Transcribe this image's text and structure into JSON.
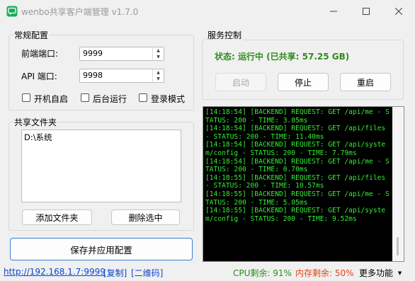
{
  "window": {
    "title": "wenbo共享客户端管理 v1.7.0"
  },
  "config": {
    "legend": "常规配置",
    "frontend_port_label": "前端端口:",
    "frontend_port_value": "9999",
    "api_port_label": "API 端口:",
    "api_port_value": "9998",
    "autostart_label": "开机自启",
    "background_label": "后台运行",
    "login_mode_label": "登录模式"
  },
  "shares": {
    "legend": "共享文件夹",
    "folders": [
      "D:\\系统"
    ],
    "add_label": "添加文件夹",
    "remove_label": "删除选中"
  },
  "save_button_label": "保存并应用配置",
  "service": {
    "legend": "服务控制",
    "status_text": "状态: 运行中 (已共享: 57.25 GB)",
    "status_color": "#2e8b1e",
    "start_label": "启动",
    "stop_label": "停止",
    "restart_label": "重启"
  },
  "log_lines": [
    "[14:18:54] [BACKEND] REQUEST: GET /api/me - STATUS: 200 - TIME: 3.05ms",
    "[14:18:54] [BACKEND] REQUEST: GET /api/files - STATUS: 200 - TIME: 11.40ms",
    "[14:18:54] [BACKEND] REQUEST: GET /api/system/config - STATUS: 200 - TIME: 7.79ms",
    "[14:18:54] [BACKEND] REQUEST: GET /api/me - STATUS: 200 - TIME: 0.70ms",
    "[14:18:55] [BACKEND] REQUEST: GET /api/files - STATUS: 200 - TIME: 10.57ms",
    "[14:18:55] [BACKEND] REQUEST: GET /api/me - STATUS: 200 - TIME: 5.05ms",
    "[14:18:55] [BACKEND] REQUEST: GET /api/system/config - STATUS: 200 - TIME: 9.52ms"
  ],
  "statusbar": {
    "url": "http://192.168.1.7:9999",
    "copy_label": "[复制]",
    "qr_label": "[二维码]",
    "cpu_text": "CPU剩余: 91%",
    "cpu_color": "#2e8b1e",
    "mem_text": "内存剩余: 50%",
    "mem_color": "#e0451a",
    "more_label": "更多功能"
  }
}
